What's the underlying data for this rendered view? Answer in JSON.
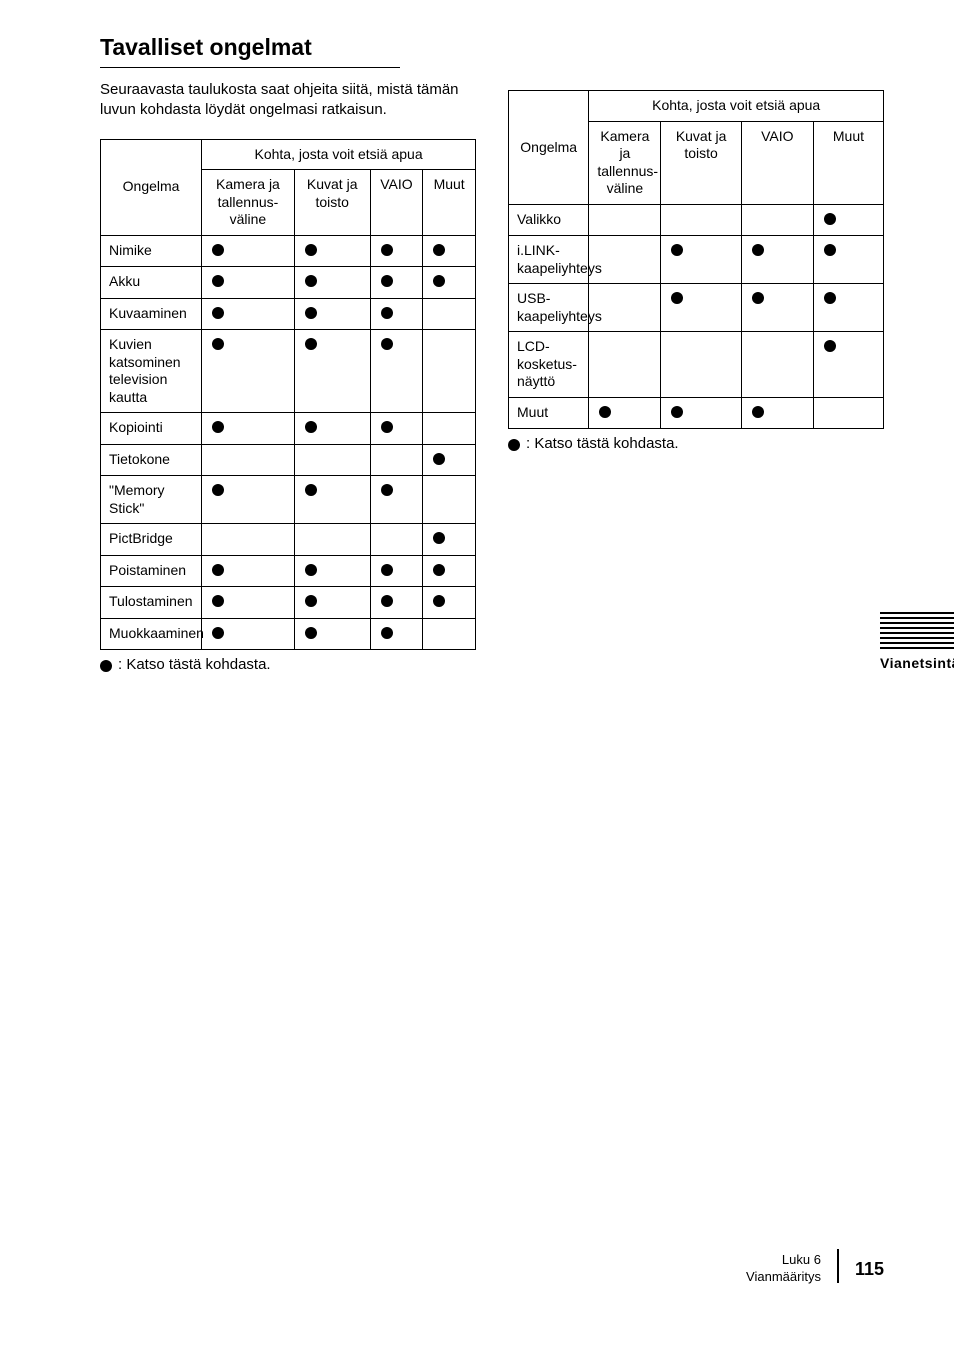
{
  "page": {
    "header": "Tavalliset ongelmat",
    "intro": "Seuraavasta taulukosta saat ohjeita siitä, mistä tämän luvun kohdasta löydät ongelmasi ratkaisun.",
    "legend": ": Katso tästä kohdasta.",
    "sidebar_label": "Vianetsintä",
    "footer": {
      "chapter_line_1": "Luku 6",
      "chapter_line_2": "Vianmääritys",
      "page_number": "115"
    }
  },
  "table1": {
    "row_header": "Ongelma",
    "col_group": "Kohta, josta voit etsiä apua",
    "cols": [
      "Kamera ja tallennus-väline",
      "Kuvat ja toisto",
      "VAIO",
      "Muut"
    ],
    "rows": [
      {
        "label": "Nimike",
        "marks": [
          true,
          true,
          true,
          true
        ]
      },
      {
        "label": "Akku",
        "marks": [
          true,
          true,
          true,
          true
        ]
      },
      {
        "label": "Kuvaaminen",
        "marks": [
          true,
          true,
          true,
          false
        ]
      },
      {
        "label": "Kuvien katsominen television kautta",
        "marks": [
          true,
          true,
          true,
          false
        ]
      },
      {
        "label": "Kopiointi",
        "marks": [
          true,
          true,
          true,
          false
        ]
      },
      {
        "label": "Tietokone",
        "marks": [
          false,
          false,
          false,
          true
        ]
      },
      {
        "label": "\"Memory Stick\"",
        "marks": [
          true,
          true,
          true,
          false
        ]
      },
      {
        "label": "PictBridge",
        "marks": [
          false,
          false,
          false,
          true
        ]
      },
      {
        "label": "Poistaminen",
        "marks": [
          true,
          true,
          true,
          true
        ]
      },
      {
        "label": "Tulostaminen",
        "marks": [
          true,
          true,
          true,
          true
        ]
      },
      {
        "label": "Muokkaaminen",
        "marks": [
          true,
          true,
          true,
          false
        ]
      }
    ]
  },
  "table1_note": "",
  "table2": {
    "cols_header_group": "Kohta, josta voit etsiä apua",
    "cols": [
      "Kamera ja tallennus-väline",
      "Kuvat ja toisto",
      "VAIO",
      "Muut"
    ],
    "rows": [
      {
        "label": "Valikko",
        "marks": [
          false,
          false,
          false,
          true
        ]
      },
      {
        "label": "i.LINK-kaapeliyhteys",
        "marks": [
          false,
          true,
          true,
          true
        ]
      },
      {
        "label": "USB-kaapeliyhteys",
        "marks": [
          false,
          true,
          true,
          true
        ]
      },
      {
        "label": "LCD-kosketus-näyttö",
        "marks": [
          false,
          false,
          false,
          true
        ]
      },
      {
        "label": "Muut",
        "marks": [
          true,
          true,
          true,
          false
        ]
      }
    ]
  }
}
